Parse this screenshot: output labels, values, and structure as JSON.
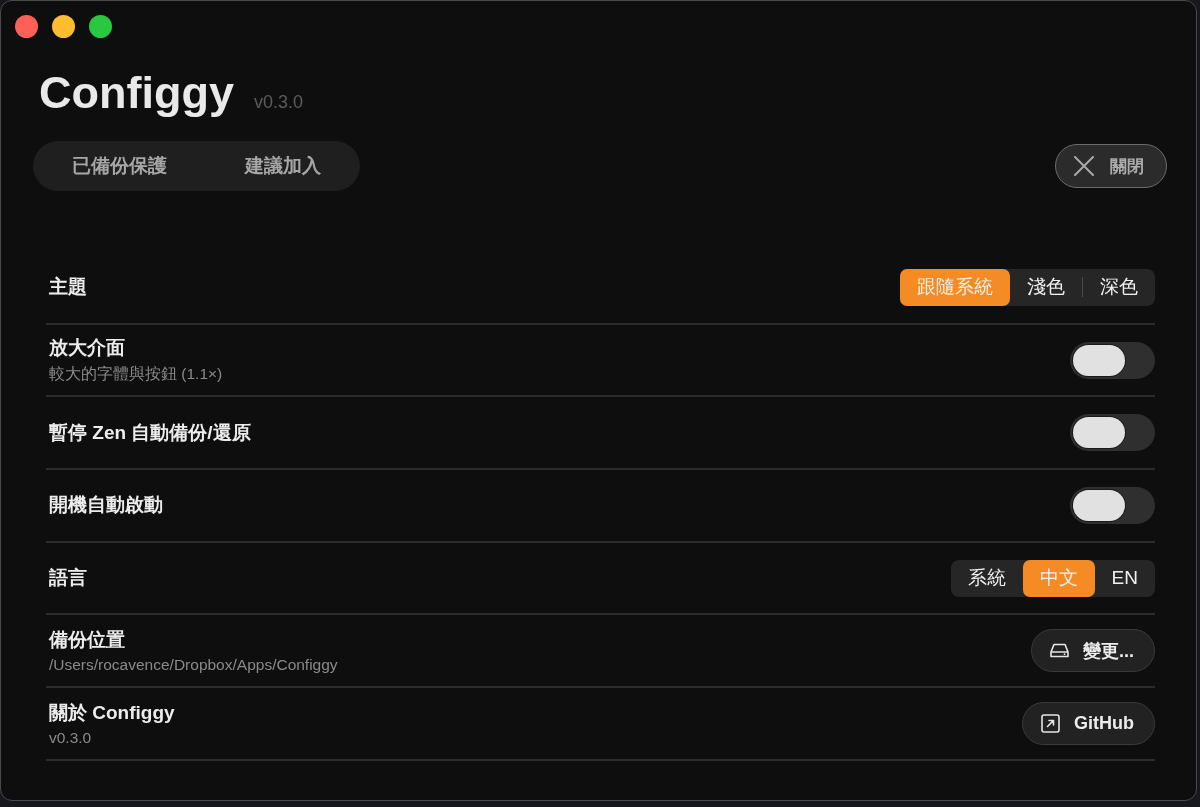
{
  "window": {
    "title": "Configgy",
    "version": "v0.3.0"
  },
  "tabs": [
    {
      "label": "已備份保護",
      "selected": false
    },
    {
      "label": "建議加入",
      "selected": false
    }
  ],
  "close_button": {
    "label": "關閉"
  },
  "settings": [
    {
      "kind": "segmented",
      "label": "主題",
      "options": [
        {
          "label": "跟隨系統",
          "selected": true
        },
        {
          "label": "淺色",
          "selected": false
        },
        {
          "label": "深色",
          "selected": false
        }
      ]
    },
    {
      "kind": "toggle",
      "label": "放大介面",
      "description": "較大的字體與按鈕 (1.1×)",
      "on": false
    },
    {
      "kind": "toggle",
      "label": "暫停 Zen 自動備份/還原",
      "on": false
    },
    {
      "kind": "toggle",
      "label": "開機自動啟動",
      "on": false
    },
    {
      "kind": "segmented",
      "label": "語言",
      "options": [
        {
          "label": "系統",
          "selected": false
        },
        {
          "label": "中文",
          "selected": true
        },
        {
          "label": "EN",
          "selected": false
        }
      ]
    },
    {
      "kind": "picker",
      "label": "備份位置",
      "description": "/Users/rocavence/Dropbox/Apps/Configgy",
      "button": {
        "label": "變更..."
      }
    },
    {
      "kind": "link",
      "label": "關於 Configgy",
      "description": "v0.3.0",
      "button": {
        "label": "GitHub"
      }
    }
  ]
}
